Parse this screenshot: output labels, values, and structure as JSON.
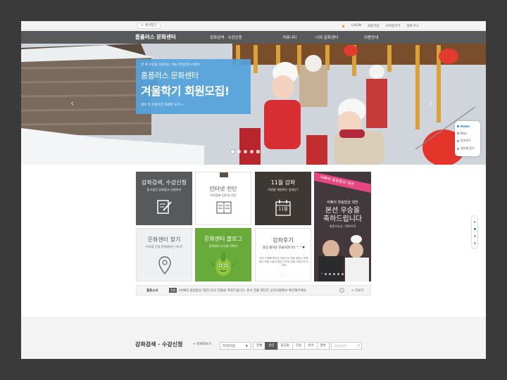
{
  "topbar": {
    "bookmark_label": "즐겨찾기",
    "links": [
      "LOGIN",
      "회원가입",
      "모바일기기",
      "장바구니"
    ]
  },
  "nav": {
    "logo": "홈플러스 문화센터",
    "menu": [
      "강좌검색 · 수강신청",
      "커뮤니티",
      "나의 문화센터",
      "이용안내"
    ]
  },
  "hero": {
    "promo_sub": "한 해 소망을 응원하는 겨울 추천강좌 모였어!",
    "promo_title1": "홈플러스 문화센터",
    "promo_title2": "겨울학기 회원모집!",
    "promo_link": "접수 및 수강기간 자세히 보기 >",
    "side_menu": [
      "Home",
      "Main",
      "강좌찾기",
      "센터별 찾기"
    ]
  },
  "tiles": {
    "t1": {
      "title": "강좌검색, 수강신청",
      "sub": "듣고싶던 강좌찾고 신청하기"
    },
    "t2": {
      "title": "인터넷 전단",
      "sub": "우리점포 인터넷 전단"
    },
    "t3": {
      "title": "11월 강좌",
      "sub": "이번달 개강하는 강좌는?",
      "cal": "11월"
    },
    "t4": {
      "ribbon": "아빠의 힐링밥상 대전",
      "line1": "아빠의 힐링밥상 대전",
      "line2a": "본선 우승을",
      "line2b": "축하드립니다",
      "line3": "최종우승자 : 000가족"
    },
    "t5": {
      "title": "문화센터 찾기",
      "sub": "우리집 근처 문화센터는 어디?"
    },
    "t6": {
      "title": "문화센터 블로그",
      "sub": "문화센터 소식과 이야기"
    },
    "t7": {
      "title": "강좌후기",
      "body": "항상 즐거운 한솥요한나라 ^.^♥",
      "body2": "우리 스탑♥ 화이트 데이나서 처음 접하는 문화센터 제발 소중이 좋았 자극한 한솥 요한나라 이 시작!",
      "more": "..."
    }
  },
  "ticker": {
    "label": "점포소식",
    "tag": "전체",
    "text": "[아빠의 힐링밥상 대전] 본선 진출을 축하드립니다. 본선 진출 명단은 공지사항에서 확인해주세요",
    "more": "+ 더보기"
  },
  "search_section": {
    "title": "강좌검색 · 수강신청",
    "sub": "+ 자세히보기",
    "region_select": "지역/지점",
    "filters": [
      "전체",
      "성인",
      "중고등",
      "초등",
      "유아",
      "영아"
    ],
    "search_placeholder": "강좌명입력"
  }
}
